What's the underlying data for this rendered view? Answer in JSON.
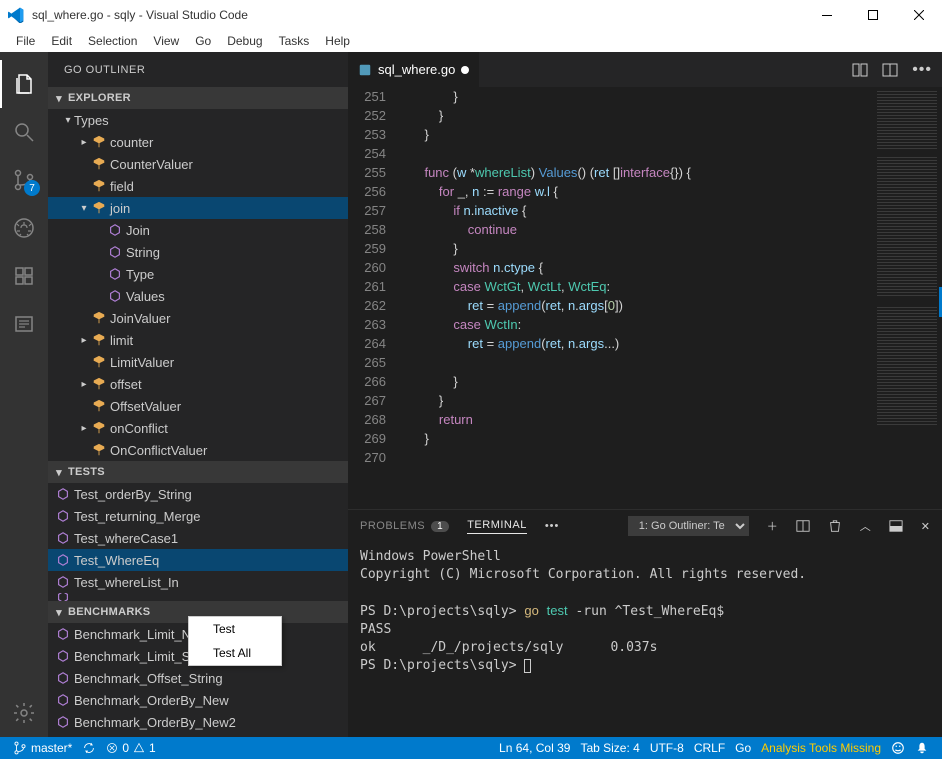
{
  "title": "sql_where.go - sqly - Visual Studio Code",
  "menu": [
    "File",
    "Edit",
    "Selection",
    "View",
    "Go",
    "Debug",
    "Tasks",
    "Help"
  ],
  "activity_badge": "7",
  "sidebar": {
    "header": "GO OUTLINER",
    "sections": {
      "explorer": "EXPLORER",
      "tests": "TESTS",
      "benchmarks": "BENCHMARKS"
    },
    "types_label": "Types",
    "explorer_items": [
      {
        "label": "counter",
        "indent": 2,
        "chev": "▸",
        "icon": "struct"
      },
      {
        "label": "CounterValuer",
        "indent": 2,
        "chev": "",
        "icon": "struct"
      },
      {
        "label": "field",
        "indent": 2,
        "chev": "",
        "icon": "struct"
      },
      {
        "label": "join",
        "indent": 2,
        "chev": "▾",
        "icon": "struct",
        "sel": true
      },
      {
        "label": "Join",
        "indent": 3,
        "chev": "",
        "icon": "method"
      },
      {
        "label": "String",
        "indent": 3,
        "chev": "",
        "icon": "method"
      },
      {
        "label": "Type",
        "indent": 3,
        "chev": "",
        "icon": "method"
      },
      {
        "label": "Values",
        "indent": 3,
        "chev": "",
        "icon": "method"
      },
      {
        "label": "JoinValuer",
        "indent": 2,
        "chev": "",
        "icon": "struct"
      },
      {
        "label": "limit",
        "indent": 2,
        "chev": "▸",
        "icon": "struct"
      },
      {
        "label": "LimitValuer",
        "indent": 2,
        "chev": "",
        "icon": "struct"
      },
      {
        "label": "offset",
        "indent": 2,
        "chev": "▸",
        "icon": "struct"
      },
      {
        "label": "OffsetValuer",
        "indent": 2,
        "chev": "",
        "icon": "struct"
      },
      {
        "label": "onConflict",
        "indent": 2,
        "chev": "▸",
        "icon": "struct"
      },
      {
        "label": "OnConflictValuer",
        "indent": 2,
        "chev": "",
        "icon": "struct"
      }
    ],
    "tests_items": [
      {
        "label": "Test_orderBy_String"
      },
      {
        "label": "Test_returning_Merge"
      },
      {
        "label": "Test_whereCase1"
      },
      {
        "label": "Test_WhereEq",
        "sel": true
      },
      {
        "label": "Test_whereList_In"
      }
    ],
    "bench_items": [
      {
        "label": "Benchmark_Limit_New"
      },
      {
        "label": "Benchmark_Limit_String"
      },
      {
        "label": "Benchmark_Offset_String"
      },
      {
        "label": "Benchmark_OrderBy_New"
      },
      {
        "label": "Benchmark_OrderBy_New2"
      }
    ]
  },
  "context_menu": [
    "Test",
    "Test All"
  ],
  "tab": {
    "label": "sql_where.go",
    "modified": true
  },
  "code": {
    "start": 251,
    "lines": [
      "            }",
      "        }",
      "    }",
      "",
      "    func (w *whereList) Values() (ret []interface{}) {",
      "        for _, n := range w.l {",
      "            if n.inactive {",
      "                continue",
      "            }",
      "            switch n.ctype {",
      "            case WctGt, WctLt, WctEq:",
      "                ret = append(ret, n.args[0])",
      "            case WctIn:",
      "                ret = append(ret, n.args...)",
      "",
      "            }",
      "        }",
      "        return",
      "    }",
      ""
    ]
  },
  "panel": {
    "problems": "PROBLEMS",
    "problems_count": "1",
    "terminal": "TERMINAL",
    "dropdown": "1: Go Outliner: Te",
    "lines": [
      "Windows PowerShell",
      "Copyright (C) Microsoft Corporation. All rights reserved.",
      "",
      "PS D:\\projects\\sqly> go test -run ^Test_WhereEq$",
      "PASS",
      "ok      _/D_/projects/sqly      0.037s",
      "PS D:\\projects\\sqly> "
    ]
  },
  "status": {
    "branch": "master*",
    "errors": "0",
    "warnings": "1",
    "lncol": "Ln 64, Col 39",
    "tabsize": "Tab Size: 4",
    "encoding": "UTF-8",
    "eol": "CRLF",
    "lang": "Go",
    "analysis": "Analysis Tools Missing"
  },
  "chart_data": null
}
